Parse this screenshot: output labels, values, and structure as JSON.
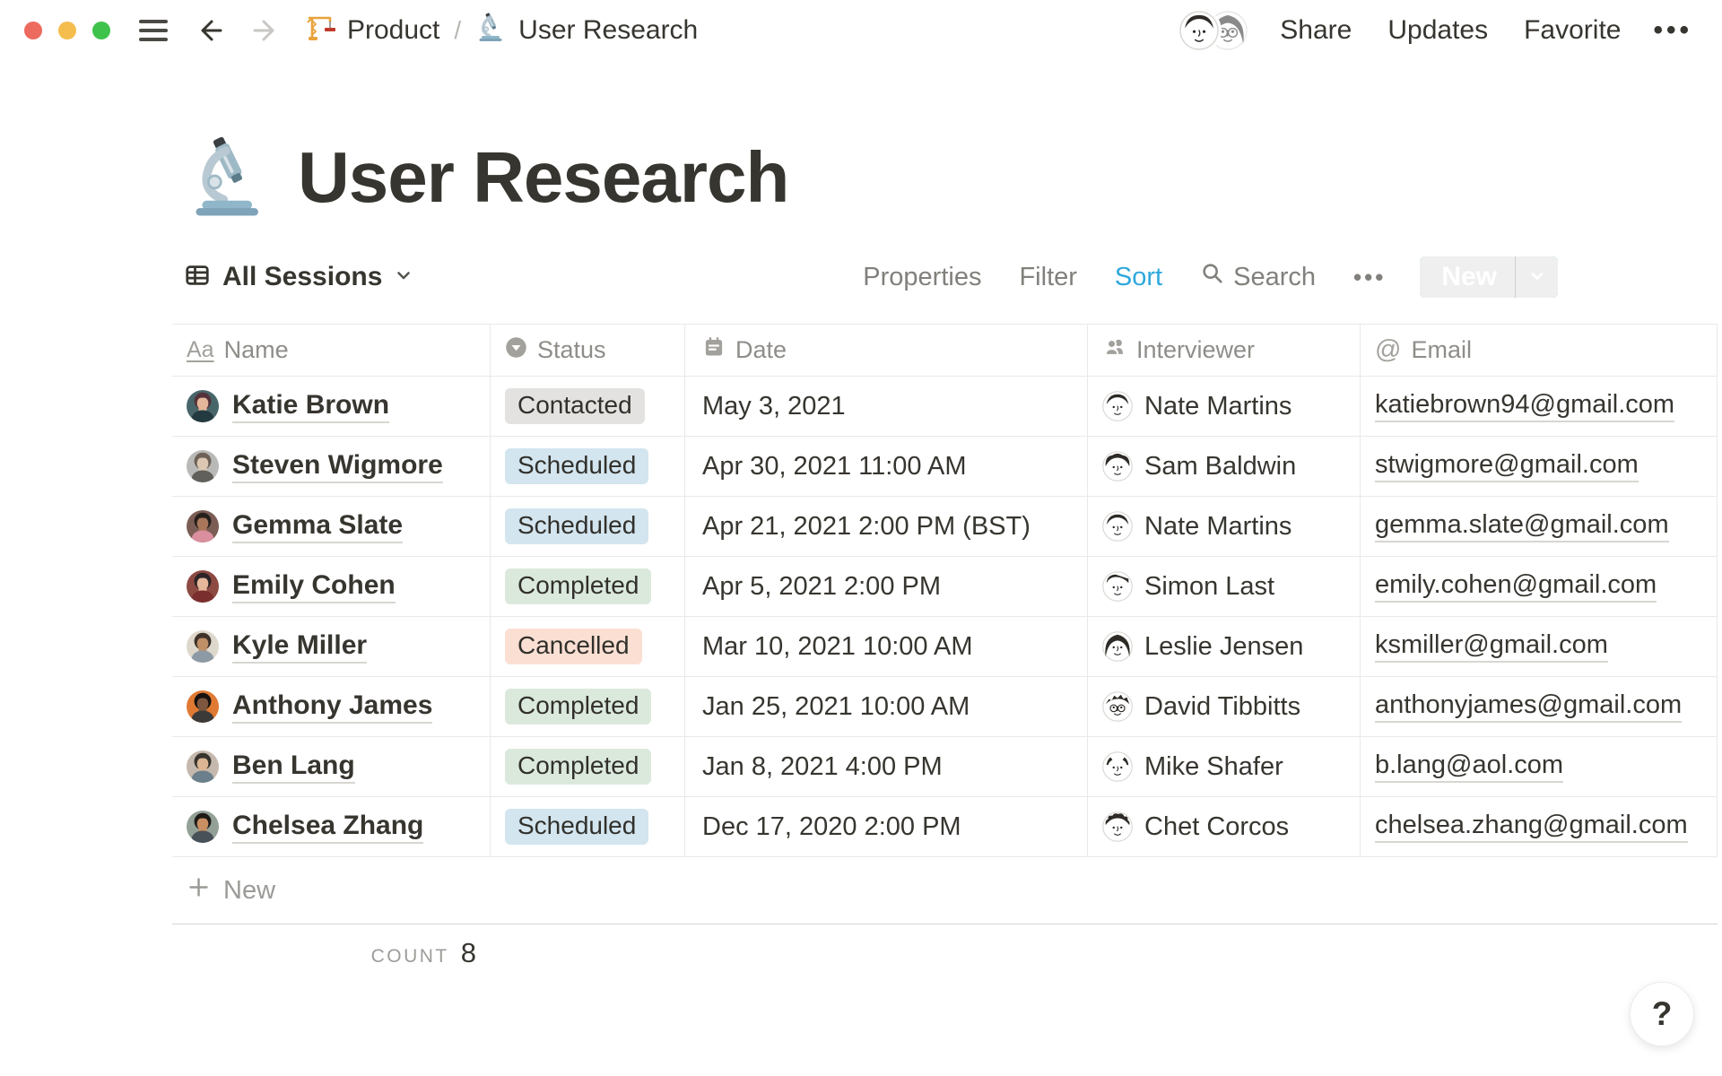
{
  "topbar": {
    "breadcrumb": [
      {
        "icon": "crane-icon",
        "label": "Product"
      },
      {
        "icon": "microscope-icon",
        "label": "User Research"
      }
    ],
    "separator": "/",
    "actions": {
      "share": "Share",
      "updates": "Updates",
      "favorite": "Favorite",
      "more": "•••"
    },
    "avatars": [
      {
        "name": "collaborator-1",
        "style": "short",
        "glasses": false
      },
      {
        "name": "collaborator-2",
        "style": "long",
        "glasses": true
      }
    ],
    "traffic_lights": {
      "close": "#ed6a5e",
      "minimize": "#f4bd4e",
      "zoom": "#3fc24c"
    }
  },
  "page": {
    "icon": "microscope-icon",
    "title": "User Research"
  },
  "view_bar": {
    "view_name": "All Sessions",
    "properties_label": "Properties",
    "filter_label": "Filter",
    "sort_label": "Sort",
    "search_label": "Search",
    "more_label": "•••",
    "new_label": "New",
    "accent": "#2ea8dc",
    "sort_active": true
  },
  "table": {
    "columns": [
      {
        "key": "name",
        "label": "Name",
        "icon": "title-icon"
      },
      {
        "key": "status",
        "label": "Status",
        "icon": "select-icon"
      },
      {
        "key": "date",
        "label": "Date",
        "icon": "calendar-icon"
      },
      {
        "key": "interviewer",
        "label": "Interviewer",
        "icon": "person-icon"
      },
      {
        "key": "email",
        "label": "Email",
        "icon": "at-icon"
      }
    ],
    "status_colors": {
      "Contacted": "#e3e2e0",
      "Scheduled": "#d3e5ef",
      "Completed": "#dbe9dd",
      "Cancelled": "#fbdfd3"
    },
    "rows": [
      {
        "name": "Katie Brown",
        "status": "Contacted",
        "date": "May 3, 2021",
        "interviewer": "Nate Martins",
        "email": "katiebrown94@gmail.com",
        "avatar": {
          "bg": "#48666a",
          "hair": "#53323a",
          "skin": "#e5b79b",
          "shirt": "#233a40"
        },
        "interviewer_avatar": {
          "hair": "short",
          "glasses": false
        }
      },
      {
        "name": "Steven Wigmore",
        "status": "Scheduled",
        "date": "Apr 30, 2021 11:00 AM",
        "interviewer": "Sam Baldwin",
        "email": "stwigmore@gmail.com",
        "avatar": {
          "bg": "#b9b9b7",
          "hair": "#6e6258",
          "skin": "#dcc7b2",
          "shirt": "#62605c"
        },
        "interviewer_avatar": {
          "hair": "fluffy",
          "glasses": false
        }
      },
      {
        "name": "Gemma Slate",
        "status": "Scheduled",
        "date": "Apr 21, 2021 2:00 PM (BST)",
        "interviewer": "Nate Martins",
        "email": "gemma.slate@gmail.com",
        "avatar": {
          "bg": "#7b5d55",
          "hair": "#27201d",
          "skin": "#a9765a",
          "shirt": "#d98f9d"
        },
        "interviewer_avatar": {
          "hair": "short",
          "glasses": false
        }
      },
      {
        "name": "Emily Cohen",
        "status": "Completed",
        "date": "Apr 5, 2021 2:00 PM",
        "interviewer": "Simon Last",
        "email": "emily.cohen@gmail.com",
        "avatar": {
          "bg": "#8c4a42",
          "hair": "#2c2326",
          "skin": "#e7b79b",
          "shirt": "#7a2e2e"
        },
        "interviewer_avatar": {
          "hair": "part",
          "glasses": false
        }
      },
      {
        "name": "Kyle Miller",
        "status": "Cancelled",
        "date": "Mar 10, 2021 10:00 AM",
        "interviewer": "Leslie Jensen",
        "email": "ksmiller@gmail.com",
        "avatar": {
          "bg": "#ded8cc",
          "hair": "#3f332a",
          "skin": "#bf8f66",
          "shirt": "#8d9aa5"
        },
        "interviewer_avatar": {
          "hair": "long",
          "glasses": false
        }
      },
      {
        "name": "Anthony James",
        "status": "Completed",
        "date": "Jan 25, 2021 10:00 AM",
        "interviewer": "David Tibbitts",
        "email": "anthonyjames@gmail.com",
        "avatar": {
          "bg": "#e07a33",
          "hair": "#15120f",
          "skin": "#7d573f",
          "shirt": "#3c3a38"
        },
        "interviewer_avatar": {
          "hair": "messy",
          "glasses": true
        }
      },
      {
        "name": "Ben Lang",
        "status": "Completed",
        "date": "Jan 8, 2021 4:00 PM",
        "interviewer": "Mike Shafer",
        "email": "b.lang@aol.com",
        "avatar": {
          "bg": "#c5b8ac",
          "hair": "#37342f",
          "skin": "#dcb694",
          "shirt": "#6b7f8c"
        },
        "interviewer_avatar": {
          "hair": "bald",
          "glasses": false
        }
      },
      {
        "name": "Chelsea Zhang",
        "status": "Scheduled",
        "date": "Dec 17, 2020 2:00 PM",
        "interviewer": "Chet Corcos",
        "email": "chelsea.zhang@gmail.com",
        "avatar": {
          "bg": "#93a096",
          "hair": "#1f1b19",
          "skin": "#c98f63",
          "shirt": "#485058"
        },
        "interviewer_avatar": {
          "hair": "curly",
          "glasses": false
        }
      }
    ],
    "new_row_label": "New",
    "footer": {
      "count_label": "COUNT",
      "count_value": "8"
    }
  },
  "help_button": {
    "label": "?"
  }
}
